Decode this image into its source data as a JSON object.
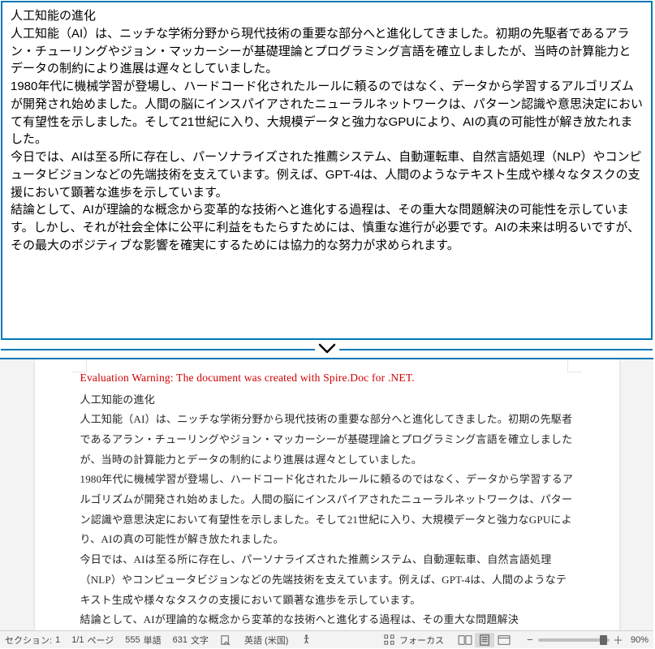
{
  "top": {
    "title": "人工知能の進化",
    "p1": "人工知能（AI）は、ニッチな学術分野から現代技術の重要な部分へと進化してきました。初期の先駆者であるアラン・チューリングやジョン・マッカーシーが基礎理論とプログラミング言語を確立しましたが、当時の計算能力とデータの制約により進展は遅々としていました。",
    "p2": "1980年代に機械学習が登場し、ハードコード化されたルールに頼るのではなく、データから学習するアルゴリズムが開発され始めました。人間の脳にインスパイアされたニューラルネットワークは、パターン認識や意思決定において有望性を示しました。そして21世紀に入り、大規模データと強力なGPUにより、AIの真の可能性が解き放たれました。",
    "p3": "今日では、AIは至る所に存在し、パーソナライズされた推薦システム、自動運転車、自然言語処理（NLP）やコンピュータビジョンなどの先端技術を支えています。例えば、GPT-4は、人間のようなテキスト生成や様々なタスクの支援において顕著な進歩を示しています。",
    "p4": "結論として、AIが理論的な概念から変革的な技術へと進化する過程は、その重大な問題解決の可能性を示しています。しかし、それが社会全体に公平に利益をもたらすためには、慎重な進行が必要です。AIの未来は明るいですが、その最大のポジティブな影響を確実にするためには協力的な努力が求められます。"
  },
  "doc": {
    "eval_warning": "Evaluation Warning: The document was created with Spire.Doc for .NET.",
    "title": "人工知能の進化",
    "p1": "人工知能（AI）は、ニッチな学術分野から現代技術の重要な部分へと進化してきました。初期の先駆者であるアラン・チューリングやジョン・マッカーシーが基礎理論とプログラミング言語を確立しましたが、当時の計算能力とデータの制約により進展は遅々としていました。",
    "p2": "1980年代に機械学習が登場し、ハードコード化されたルールに頼るのではなく、データから学習するアルゴリズムが開発され始めました。人間の脳にインスパイアされたニューラルネットワークは、パターン認識や意思決定において有望性を示しました。そして21世紀に入り、大規模データと強力なGPUにより、AIの真の可能性が解き放たれました。",
    "p3": "今日では、AIは至る所に存在し、パーソナライズされた推薦システム、自動運転車、自然言語処理（NLP）やコンピュータビジョンなどの先端技術を支えています。例えば、GPT-4は、人間のようなテキスト生成や様々なタスクの支援において顕著な進歩を示しています。",
    "p4": "結論として、AIが理論的な概念から変革的な技術へと進化する過程は、その重大な問題解決"
  },
  "status": {
    "section_label": "セクション:",
    "section_value": "1",
    "page_label": "ページ",
    "page_value": "1/1",
    "words_label": "単語",
    "words_value": "555",
    "chars_label": "文字",
    "chars_value": "631",
    "lang": "英語 (米国)",
    "focus": "フォーカス",
    "zoom": "90%"
  },
  "chevron": "❤"
}
